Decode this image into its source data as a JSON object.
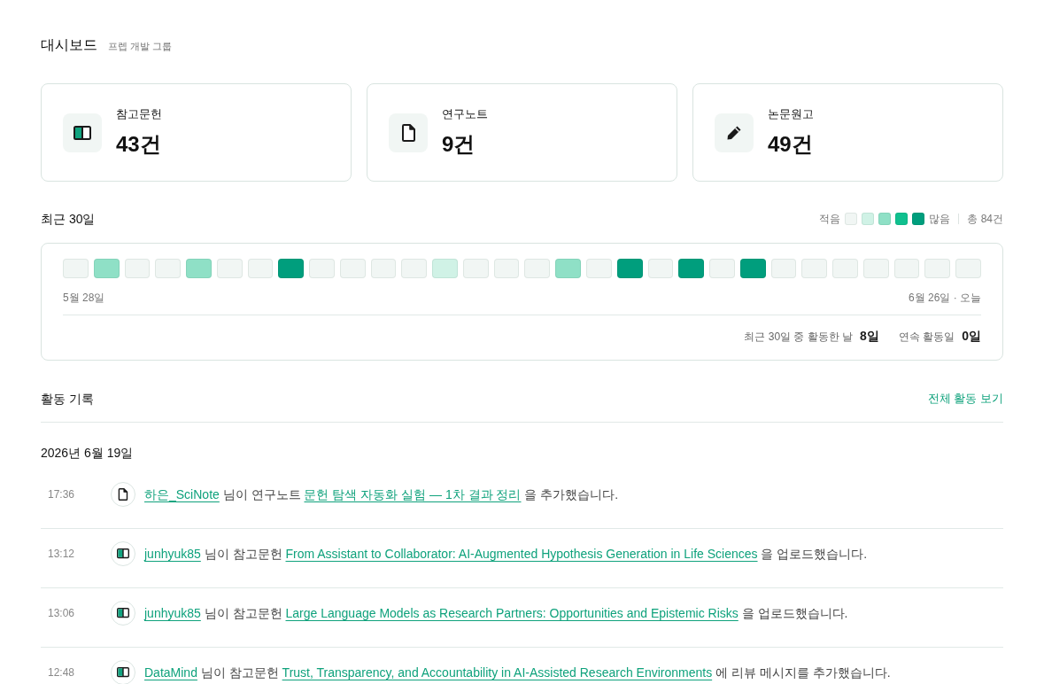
{
  "header": {
    "title": "대시보드",
    "subtitle": "프렙 개발 그룹"
  },
  "stats": [
    {
      "kind": "reference",
      "label": "참고문헌",
      "value": "43건"
    },
    {
      "kind": "note",
      "label": "연구노트",
      "value": "9건"
    },
    {
      "kind": "draft",
      "label": "논문원고",
      "value": "49건"
    }
  ],
  "recent": {
    "title": "최근 30일",
    "legend": {
      "low": "적음",
      "swatches": [
        {
          "color": "#f1f6f4"
        },
        {
          "color": "#d0f2e6"
        },
        {
          "color": "#8fe0c6"
        },
        {
          "color": "#10c08f"
        },
        {
          "color": "#009e7d"
        }
      ],
      "high": "많음",
      "total": "총 84건"
    },
    "days": [
      {
        "color": "#f1f6f4"
      },
      {
        "color": "#8fe0c6"
      },
      {
        "color": "#f1f6f4"
      },
      {
        "color": "#f1f6f4"
      },
      {
        "color": "#8fe0c6"
      },
      {
        "color": "#f1f6f4"
      },
      {
        "color": "#f1f6f4"
      },
      {
        "color": "#009e7d"
      },
      {
        "color": "#f1f6f4"
      },
      {
        "color": "#f1f6f4"
      },
      {
        "color": "#f1f6f4"
      },
      {
        "color": "#f1f6f4"
      },
      {
        "color": "#d0f2e6"
      },
      {
        "color": "#f1f6f4"
      },
      {
        "color": "#f1f6f4"
      },
      {
        "color": "#f1f6f4"
      },
      {
        "color": "#8fe0c6"
      },
      {
        "color": "#f1f6f4"
      },
      {
        "color": "#009e7d"
      },
      {
        "color": "#f1f6f4"
      },
      {
        "color": "#009e7d"
      },
      {
        "color": "#f1f6f4"
      },
      {
        "color": "#009e7d"
      },
      {
        "color": "#f1f6f4"
      },
      {
        "color": "#f1f6f4"
      },
      {
        "color": "#f1f6f4"
      },
      {
        "color": "#f1f6f4"
      },
      {
        "color": "#f1f6f4"
      },
      {
        "color": "#f1f6f4"
      },
      {
        "color": "#f1f6f4"
      }
    ],
    "start_label": "5월 28일",
    "end_label": "6월 26일 · 오늘",
    "summary": [
      {
        "label": "최근 30일 중 활동한 날",
        "value": "8일"
      },
      {
        "label": "연속 활동일",
        "value": "0일"
      }
    ]
  },
  "activity": {
    "title": "활동 기록",
    "view_all": "전체 활동 보기",
    "groups": [
      {
        "date": "2026년 6월 19일",
        "items": [
          {
            "time": "17:36",
            "kind": "note",
            "user": "하은_SciNote",
            "before": "님이 연구노트",
            "target": "문헌 탐색 자동화 실험 — 1차 결과 정리",
            "after": "을 추가했습니다."
          },
          {
            "time": "13:12",
            "kind": "reference",
            "user": "junhyuk85",
            "before": "님이 참고문헌",
            "target": "From Assistant to Collaborator: AI-Augmented Hypothesis Generation in Life Sciences",
            "after": "을 업로드했습니다."
          },
          {
            "time": "13:06",
            "kind": "reference",
            "user": "junhyuk85",
            "before": "님이 참고문헌",
            "target": "Large Language Models as Research Partners: Opportunities and Epistemic Risks",
            "after": "을 업로드했습니다."
          },
          {
            "time": "12:48",
            "kind": "reference",
            "user": "DataMind",
            "before": "님이 참고문헌",
            "target": "Trust, Transparency, and Accountability in AI-Assisted Research Environments",
            "after": "에 리뷰 메시지를 추가했습니다."
          }
        ]
      }
    ]
  }
}
